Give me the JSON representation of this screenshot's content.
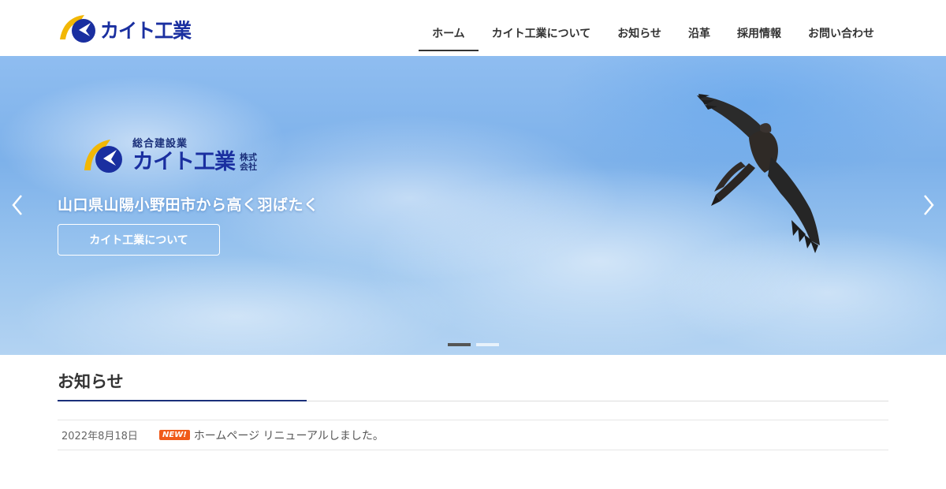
{
  "colors": {
    "brand_blue": "#1a2fa0",
    "brand_yellow": "#f2b705",
    "badge_orange": "#f05a1a",
    "sky_blue": "#7db1ea"
  },
  "header": {
    "logo_text": "カイト工業",
    "nav": [
      {
        "label": "ホーム",
        "active": true
      },
      {
        "label": "カイト工業について"
      },
      {
        "label": "お知らせ"
      },
      {
        "label": "沿革"
      },
      {
        "label": "採用情報"
      },
      {
        "label": "お問い合わせ"
      }
    ]
  },
  "hero": {
    "logo_sub": "総合建設業",
    "logo_main": "カイト工業",
    "logo_suffix": "株式会社",
    "tagline": "山口県山陽小野田市から高く羽ばたく",
    "button_label": "カイト工業について",
    "prev_icon": "chevron-left-icon",
    "next_icon": "chevron-right-icon",
    "slides_total": 2,
    "slide_active": 1
  },
  "news": {
    "title": "お知らせ",
    "items": [
      {
        "date": "2022年8月18日",
        "badge": "NEW!",
        "text": "ホームページ リニューアルしました。"
      }
    ]
  }
}
